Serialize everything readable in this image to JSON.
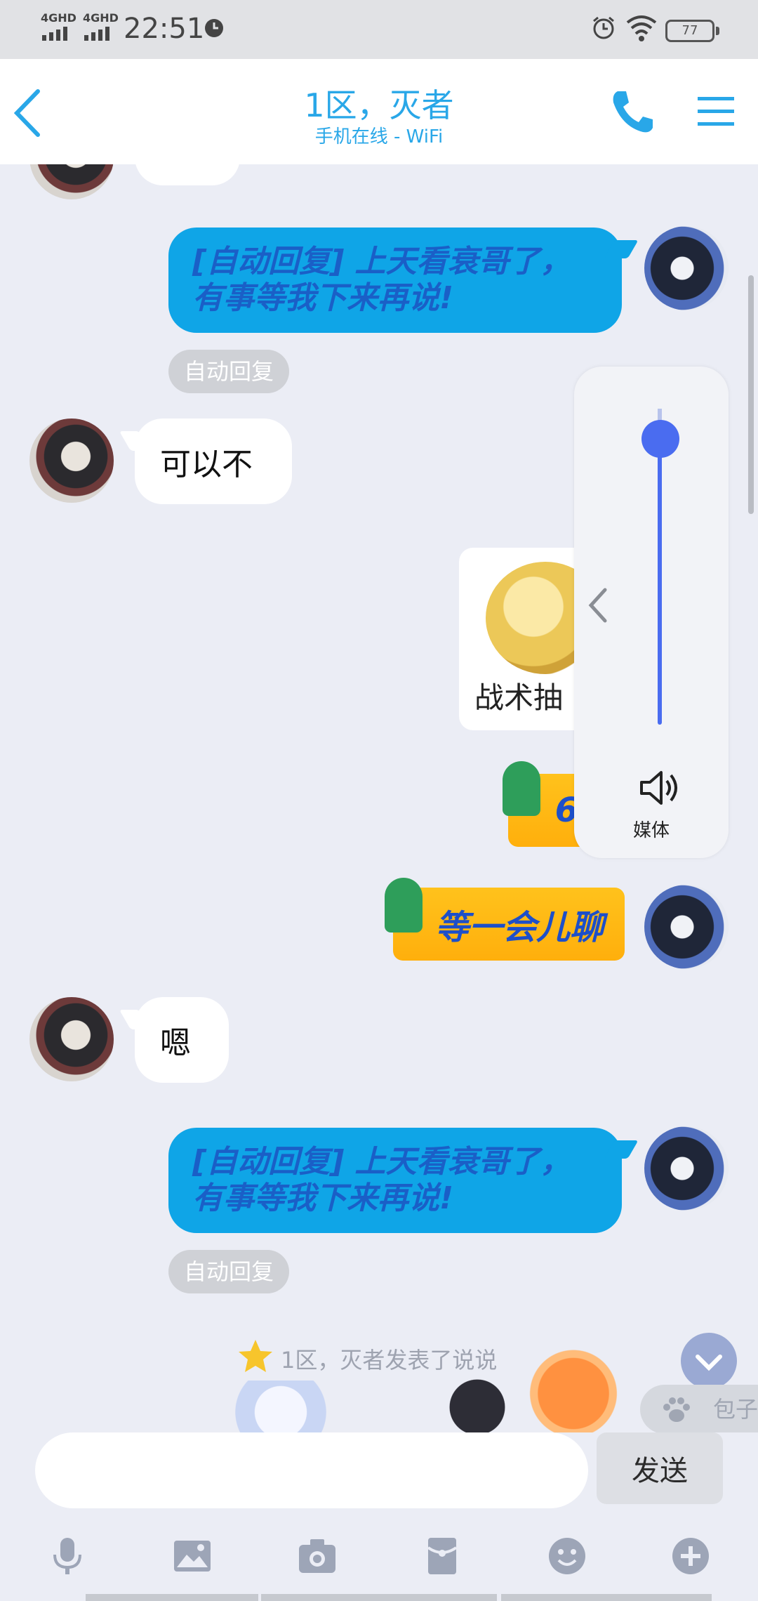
{
  "status_bar": {
    "network1": "4GHD",
    "network2": "4GHD",
    "time": "22:51",
    "battery": "77"
  },
  "header": {
    "title": "1区，灭者",
    "subtitle": "手机在线 - WiFi"
  },
  "messages": {
    "out1": "[自动回复] 上天看衰哥了，有事等我下来再说!",
    "tag1": "自动回复",
    "in1": "可以不",
    "sticker1_caption": "战术抽",
    "sticker2_text": "66",
    "sticker3_text": "等一会儿聊",
    "in2": "嗯",
    "out2": "[自动回复] 上天看衰哥了，有事等我下来再说!",
    "tag2": "自动回复"
  },
  "volume_popup": {
    "label": "媒体",
    "level": 0.93
  },
  "banner": {
    "text": "1区，灭者发表了说说"
  },
  "paw_pill": {
    "text": "包子"
  },
  "input_bar": {
    "placeholder": "",
    "send_label": "发送"
  },
  "icons": {
    "toolbar": [
      "microphone-icon",
      "image-icon",
      "camera-icon",
      "red-packet-icon",
      "emoji-icon",
      "plus-icon"
    ]
  }
}
